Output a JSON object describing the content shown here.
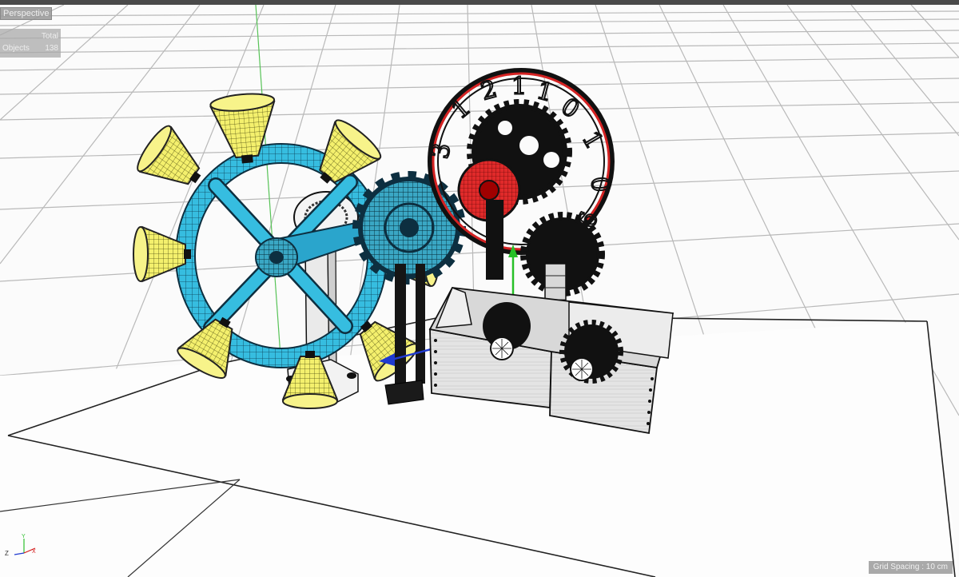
{
  "viewport": {
    "view_name": "Perspective",
    "stats_header": "Total",
    "stats_label": "Objects",
    "stats_value": "138",
    "grid_spacing": "Grid Spacing : 10 cm"
  },
  "axis_gizmo": {
    "y_label": "Y",
    "z_label": "Z",
    "x_label": "X"
  },
  "colors": {
    "wheel": "#31b6d8",
    "bells": "#f2ef6a",
    "clock_ring": "#d42222",
    "gears": "#111111",
    "box": "#e6e6e6",
    "axis_y": "#2ec02e",
    "axis_x": "#d41818",
    "axis_z": "#1f3ad0"
  }
}
